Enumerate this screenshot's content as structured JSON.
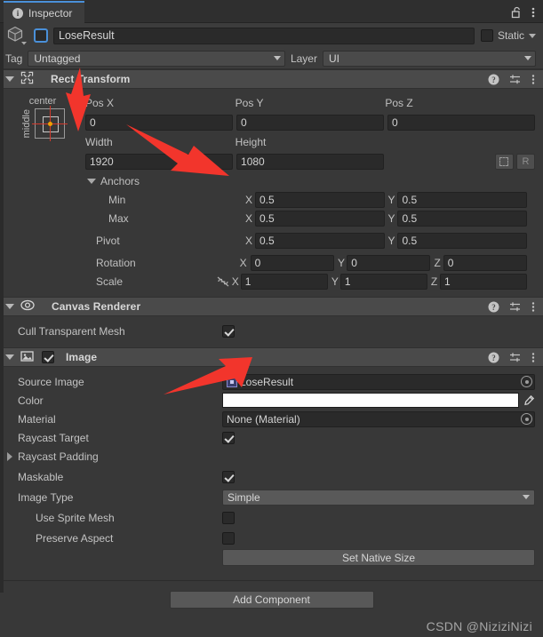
{
  "window": {
    "tab_label": "Inspector",
    "tab_icon": "info-icon",
    "lock_icon": "lock-open-icon",
    "menu_icon": "kebab-menu-icon"
  },
  "gameobject": {
    "icon": "cube-icon",
    "enabled": false,
    "name": "LoseResult",
    "static_label": "Static",
    "tag_label": "Tag",
    "tag_value": "Untagged",
    "layer_label": "Layer",
    "layer_value": "UI"
  },
  "components": [
    {
      "name": "Rect Transform",
      "icon": "rect-transform-icon",
      "expanded": true
    },
    {
      "name": "Canvas Renderer",
      "icon": "eye-icon",
      "expanded": true
    },
    {
      "name": "Image",
      "icon": "image-component-icon",
      "expanded": true,
      "enabled": true
    }
  ],
  "rect_transform": {
    "anchor_preset": {
      "horizontal": "center",
      "vertical": "middle"
    },
    "headers": {
      "pos_x": "Pos X",
      "pos_y": "Pos Y",
      "pos_z": "Pos Z",
      "width": "Width",
      "height": "Height"
    },
    "pos_x": "0",
    "pos_y": "0",
    "pos_z": "0",
    "width": "1920",
    "height": "1080",
    "blueprint_icon": "blueprint-mode-icon",
    "raw_label": "R",
    "anchors_label": "Anchors",
    "min_label": "Min",
    "max_label": "Max",
    "pivot_label": "Pivot",
    "rotation_label": "Rotation",
    "scale_label": "Scale",
    "axis_x": "X",
    "axis_y": "Y",
    "axis_z": "Z",
    "anchor_min_x": "0.5",
    "anchor_min_y": "0.5",
    "anchor_max_x": "0.5",
    "anchor_max_y": "0.5",
    "pivot_x": "0.5",
    "pivot_y": "0.5",
    "rotation_x": "0",
    "rotation_y": "0",
    "rotation_z": "0",
    "scale_x": "1",
    "scale_y": "1",
    "scale_z": "1",
    "scale_link_icon": "linked-off-icon"
  },
  "canvas_renderer": {
    "cull_transparent_mesh_label": "Cull Transparent Mesh",
    "cull_transparent_mesh_checked": true
  },
  "image": {
    "source_image_label": "Source Image",
    "source_image_value": "LoseResult",
    "source_image_icon": "sprite-icon",
    "color_label": "Color",
    "color_value": "#FFFFFF",
    "eyedropper_icon": "eyedropper-icon",
    "material_label": "Material",
    "material_value": "None (Material)",
    "raycast_target_label": "Raycast Target",
    "raycast_target_checked": true,
    "raycast_padding_label": "Raycast Padding",
    "maskable_label": "Maskable",
    "maskable_checked": true,
    "image_type_label": "Image Type",
    "image_type_value": "Simple",
    "use_sprite_mesh_label": "Use Sprite Mesh",
    "use_sprite_mesh_checked": false,
    "preserve_aspect_label": "Preserve Aspect",
    "preserve_aspect_checked": false,
    "set_native_size_label": "Set Native Size"
  },
  "footer": {
    "add_component_label": "Add Component",
    "watermark": "CSDN @NiziziNizi"
  },
  "component_header_icons": {
    "help": "help-icon",
    "preset": "preset-icon",
    "menu": "kebab-menu-icon"
  },
  "colors": {
    "accent_blue": "#4a90d9",
    "panel_bg": "#383838",
    "header_bg": "#4a4a4a",
    "annotation_red": "#f2352c",
    "pivot_orange": "#f0a000"
  }
}
